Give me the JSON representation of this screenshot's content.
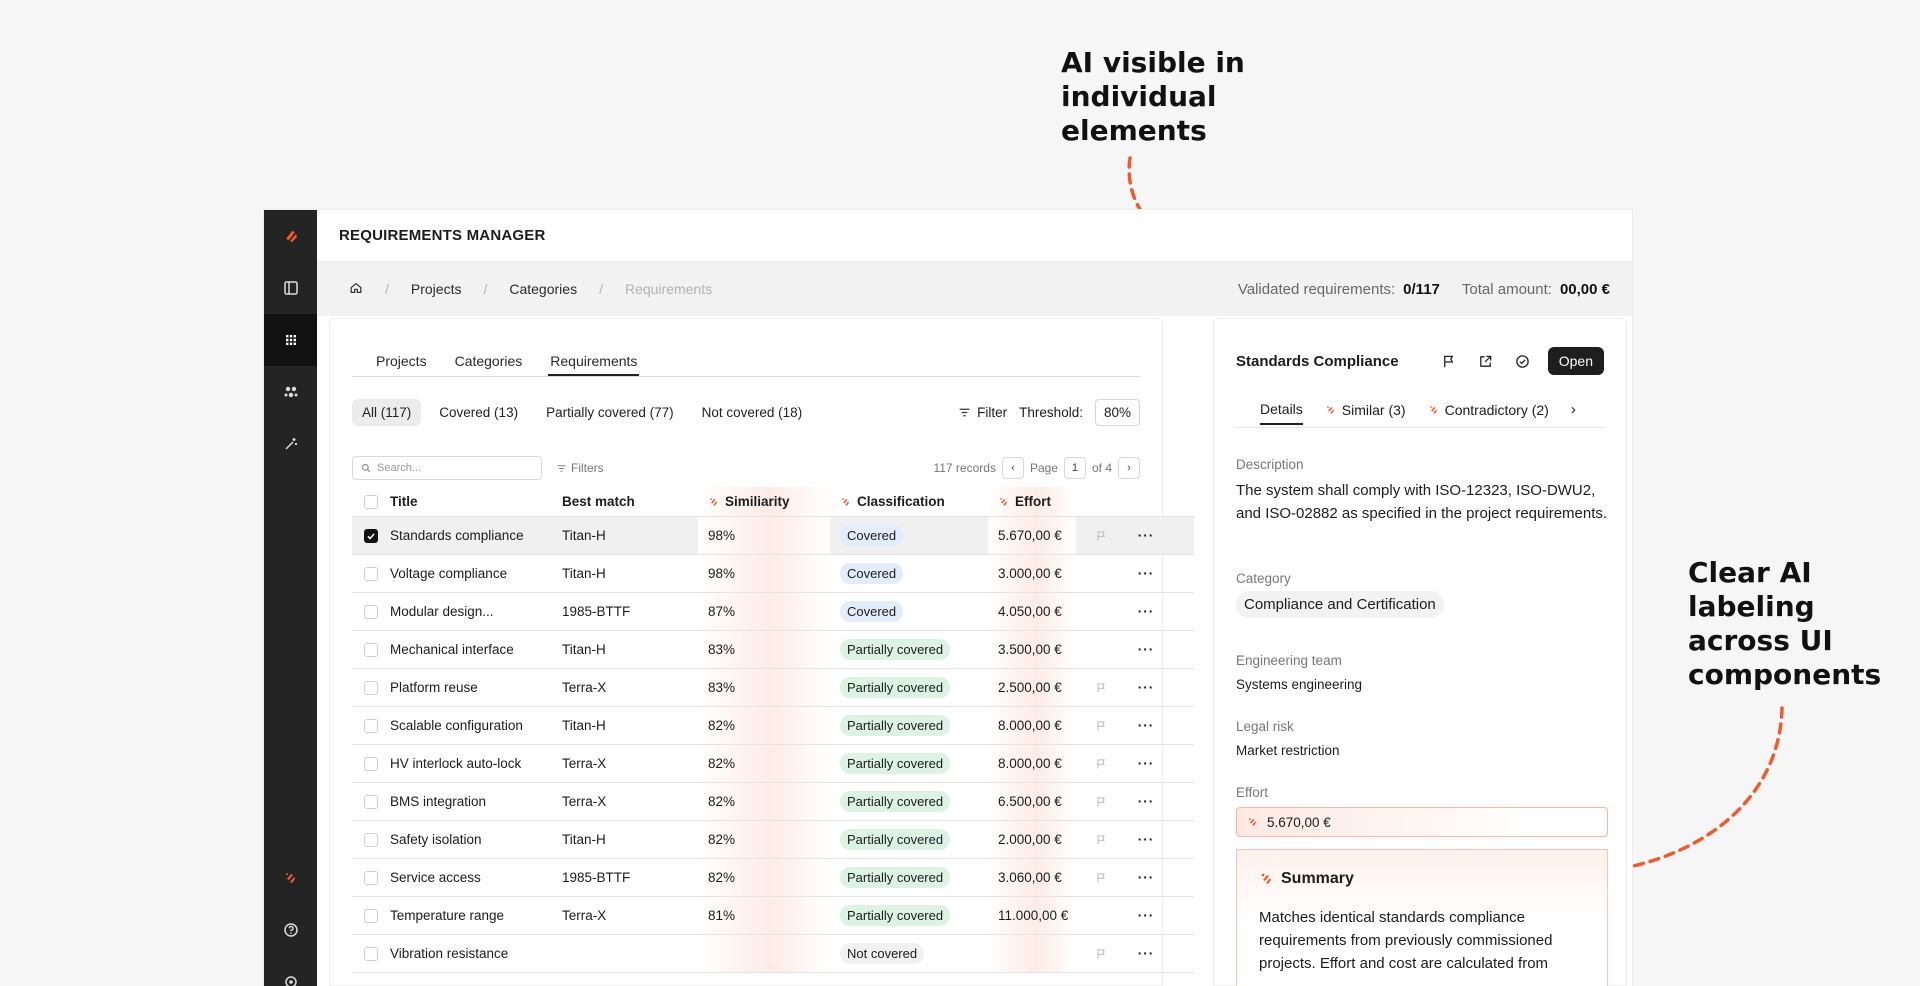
{
  "annotations": {
    "top_note": "AI visible in individual elements",
    "side_note": "Clear AI labeling across UI components"
  },
  "colors": {
    "accent": "#f05a30",
    "rail": "#242424"
  },
  "rail": {
    "items": [
      "logo",
      "sidebar-toggle-icon",
      "apps-grid-icon",
      "integrations-icon",
      "ai-magic-icon"
    ],
    "bottom": [
      "ai-logo",
      "help-icon",
      "settings-icon"
    ]
  },
  "header": {
    "title": "REQUIREMENTS MANAGER"
  },
  "breadcrumb": {
    "projects": "Projects",
    "categories": "Categories",
    "requirements": "Requirements",
    "sep": "/"
  },
  "stats": {
    "validated_label": "Validated requirements:",
    "validated_value": "0/117",
    "total_label": "Total amount:",
    "total_value": "00,00 €"
  },
  "tabs": [
    "Projects",
    "Categories",
    "Requirements"
  ],
  "filters": {
    "chips": [
      "All (117)",
      "Covered (13)",
      "Partially covered (77)",
      "Not covered (18)"
    ],
    "filter_label": "Filter",
    "threshold_label": "Threshold:",
    "threshold_value": "80%"
  },
  "toolbar": {
    "search_placeholder": "Search...",
    "filters_label": "Filters",
    "records": "117 records",
    "page_label": "Page",
    "page_value": "1",
    "page_total": "of 4"
  },
  "table": {
    "headers": {
      "title": "Title",
      "match": "Best match",
      "sim": "Similiarity",
      "cls": "Classification",
      "eff": "Effort"
    },
    "rows": [
      {
        "title": "Standards compliance",
        "match": "Titan-H",
        "sim": "98%",
        "cls": "Covered",
        "eff": "5.670,00 €"
      },
      {
        "title": "Voltage compliance",
        "match": "Titan-H",
        "sim": "98%",
        "cls": "Covered",
        "eff": "3.000,00 €"
      },
      {
        "title": "Modular design...",
        "match": "1985-BTTF",
        "sim": "87%",
        "cls": "Covered",
        "eff": "4.050,00 €"
      },
      {
        "title": "Mechanical interface",
        "match": "Titan-H",
        "sim": "83%",
        "cls": "Partially covered",
        "eff": "3.500,00 €"
      },
      {
        "title": "Platform reuse",
        "match": "Terra-X",
        "sim": "83%",
        "cls": "Partially covered",
        "eff": "2.500,00 €"
      },
      {
        "title": "Scalable configuration",
        "match": "Titan-H",
        "sim": "82%",
        "cls": "Partially covered",
        "eff": "8.000,00 €"
      },
      {
        "title": "HV interlock auto-lock",
        "match": "Terra-X",
        "sim": "82%",
        "cls": "Partially covered",
        "eff": "8.000,00 €"
      },
      {
        "title": "BMS integration",
        "match": "Terra-X",
        "sim": "82%",
        "cls": "Partially covered",
        "eff": "6.500,00 €"
      },
      {
        "title": "Safety isolation",
        "match": "Titan-H",
        "sim": "82%",
        "cls": "Partially covered",
        "eff": "2.000,00 €"
      },
      {
        "title": "Service access",
        "match": "1985-BTTF",
        "sim": "82%",
        "cls": "Partially covered",
        "eff": "3.060,00 €"
      },
      {
        "title": "Temperature range",
        "match": "Terra-X",
        "sim": "81%",
        "cls": "Partially covered",
        "eff": "11.000,00 €"
      },
      {
        "title": "Vibration resistance",
        "match": "",
        "sim": "",
        "cls": "Not covered",
        "eff": ""
      }
    ]
  },
  "detail": {
    "title": "Standards Compliance",
    "open_label": "Open",
    "tabs": {
      "details": "Details",
      "similar": "Similar (3)",
      "contradictory": "Contradictory (2)"
    },
    "description_label": "Description",
    "description": "The system shall comply with ISO-12323, ISO-DWU2, and ISO-02882 as specified in the project requirements.",
    "category_label": "Category",
    "category": "Compliance and Certification",
    "team_label": "Engineering team",
    "team": "Systems engineering",
    "risk_label": "Legal risk",
    "risk": "Market restriction",
    "effort_label": "Effort",
    "effort": "5.670,00 €",
    "summary_title": "Summary",
    "summary": "Matches identical standards compliance requirements from previously commissioned projects. Effort and cost are calculated from"
  }
}
